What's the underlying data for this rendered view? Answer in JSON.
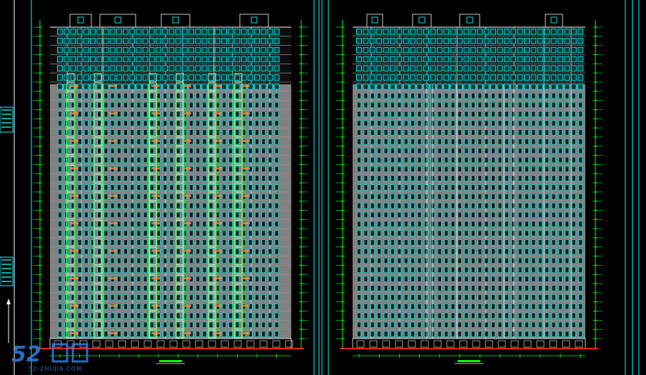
{
  "viewport": {
    "background": "#000000"
  },
  "colors": {
    "frame": "#00ffff",
    "window": "#00e5e5",
    "window_dark": "#0a3a3a",
    "wall": "#808080",
    "crown": "#0d0d0d",
    "dim": "#00ff00",
    "balcony": "#c8ffc8",
    "accent": "#ff8a3d",
    "ground": "#ff2020",
    "white": "#ffffff"
  },
  "drawings": [
    {
      "name": "left-elevation",
      "floors": 34,
      "crown_floors": 5,
      "style": "balconied"
    },
    {
      "name": "right-elevation",
      "floors": 34,
      "crown_floors": 5,
      "style": "plain"
    }
  ],
  "watermark": {
    "logo_text": "52",
    "site_text": "52-ZHUJIA.COM"
  }
}
